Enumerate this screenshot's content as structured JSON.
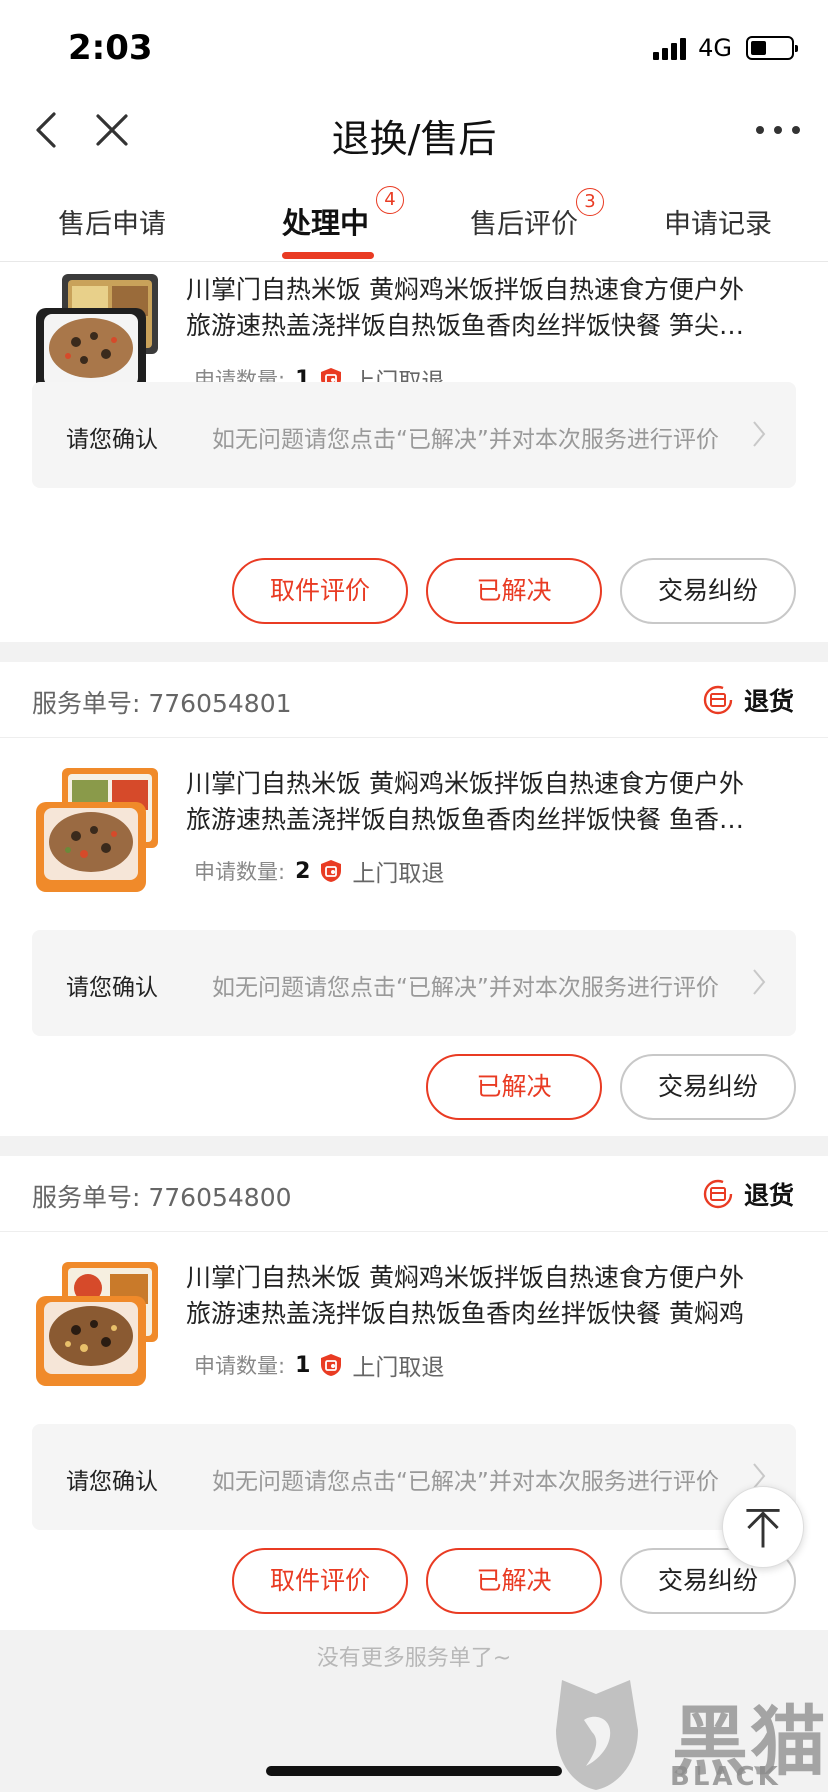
{
  "status_bar": {
    "time": "2:03",
    "network": "4G",
    "battery_level": 0.4
  },
  "nav": {
    "title": "退换/售后"
  },
  "tabs": [
    {
      "label": "售后申请",
      "badge": ""
    },
    {
      "label": "处理中",
      "badge": "4"
    },
    {
      "label": "售后评价",
      "badge": "3"
    },
    {
      "label": "申请记录",
      "badge": ""
    }
  ],
  "active_tab": "处理中",
  "cards": [
    {
      "service_no": "",
      "type": "",
      "product_lines": [
        "川掌门自热米饭 黄焖鸡米饭拌饭自热速食方便户外",
        "旅游速热盖浇拌饭自热饭鱼香肉丝拌饭快餐 笋尖…"
      ],
      "qty_label": "申请数量:",
      "qty": "1",
      "pickup": "上门取退",
      "confirm_label": "请您确认",
      "confirm_hint": "如无问题请您点击“已解决”并对本次服务进行评价",
      "buttons": [
        "取件评价",
        "已解决",
        "交易纠纷"
      ]
    },
    {
      "service_no": "服务单号:  776054801",
      "type": "退货",
      "product_lines": [
        "川掌门自热米饭 黄焖鸡米饭拌饭自热速食方便户外",
        "旅游速热盖浇拌饭自热饭鱼香肉丝拌饭快餐 鱼香…"
      ],
      "qty_label": "申请数量:",
      "qty": "2",
      "pickup": "上门取退",
      "confirm_label": "请您确认",
      "confirm_hint": "如无问题请您点击“已解决”并对本次服务进行评价",
      "buttons": [
        "已解决",
        "交易纠纷"
      ]
    },
    {
      "service_no": "服务单号:  776054800",
      "type": "退货",
      "product_lines": [
        "川掌门自热米饭 黄焖鸡米饭拌饭自热速食方便户外",
        "旅游速热盖浇拌饭自热饭鱼香肉丝拌饭快餐 黄焖鸡"
      ],
      "qty_label": "申请数量:",
      "qty": "1",
      "pickup": "上门取退",
      "confirm_label": "请您确认",
      "confirm_hint": "如无问题请您点击“已解决”并对本次服务进行评价",
      "buttons": [
        "取件评价",
        "已解决",
        "交易纠纷"
      ]
    }
  ],
  "footer": {
    "no_more": "没有更多服务单了~"
  },
  "watermark": {
    "text": "黑猫",
    "sub": "BLACK CAT"
  },
  "colors": {
    "accent": "#e93b23",
    "background": "#f2f2f2"
  }
}
